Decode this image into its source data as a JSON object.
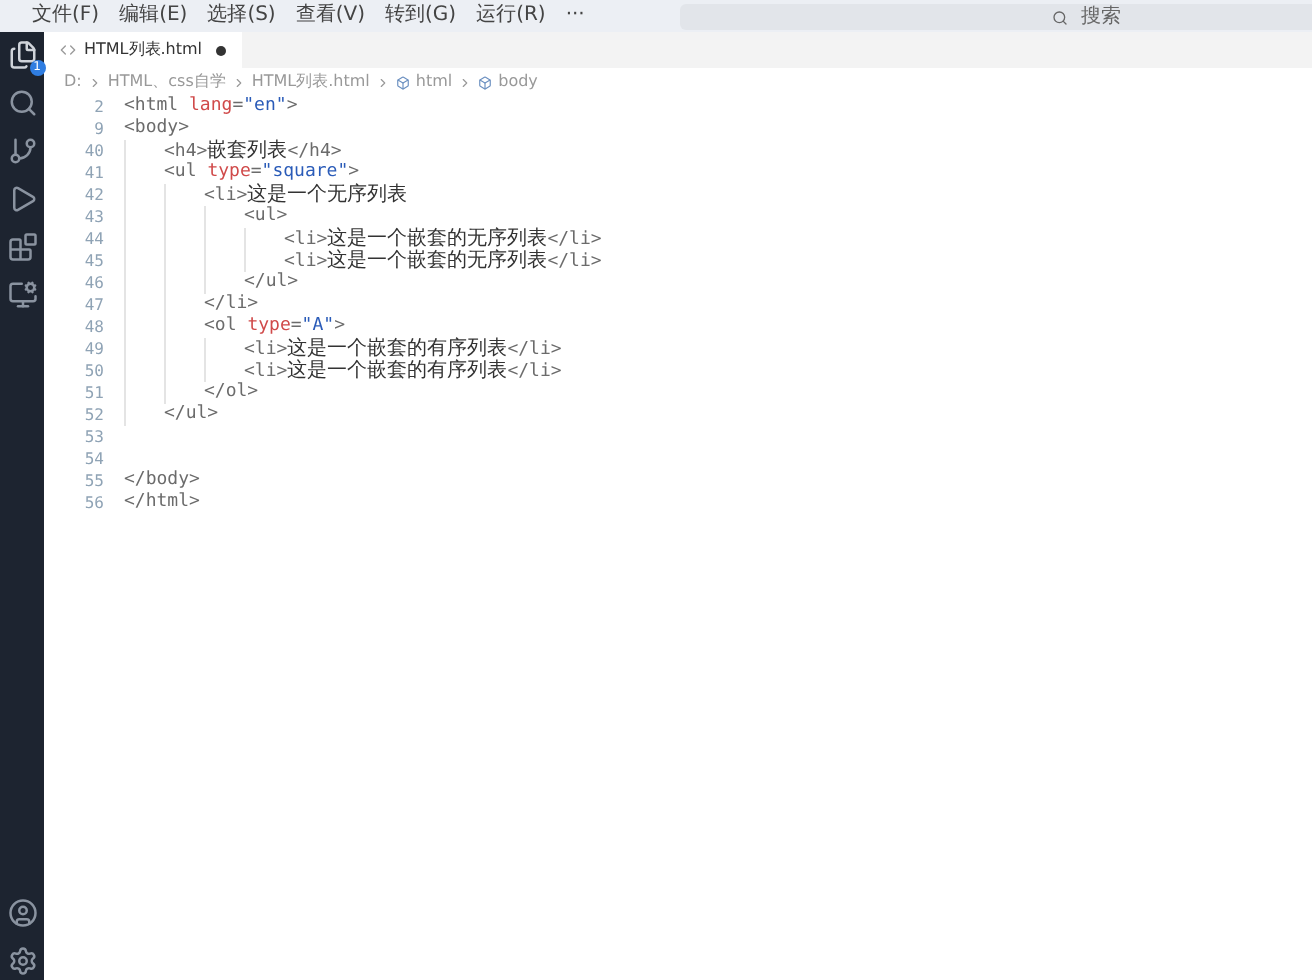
{
  "menu_bar": {
    "items": [
      "文件(F)",
      "编辑(E)",
      "选择(S)",
      "查看(V)",
      "转到(G)",
      "运行(R)",
      "···"
    ],
    "search": {
      "placeholder": "搜索"
    }
  },
  "activity_bar": {
    "explorer_badge": "1"
  },
  "tabs": [
    {
      "label": "HTML列表.html",
      "selected": true,
      "modified": true
    }
  ],
  "breadcrumb": [
    "D:",
    "HTML、css自学",
    "HTML列表.html",
    "html",
    "body"
  ],
  "code_lines": [
    {
      "number": "2",
      "tokens": [
        {
          "kind": "tag",
          "text": "<html "
        },
        {
          "kind": "attr",
          "text": "lang"
        },
        {
          "kind": "tag",
          "text": "="
        },
        {
          "kind": "value",
          "text": "\"en\""
        },
        {
          "kind": "tag",
          "text": ">"
        }
      ]
    },
    {
      "number": "9",
      "tokens": [
        {
          "kind": "tag",
          "text": "<body>"
        }
      ],
      "children": [
        {
          "number": "40",
          "tokens": [
            {
              "kind": "tag",
              "text": "<h4>"
            },
            {
              "kind": "text",
              "text": "嵌套列表"
            },
            {
              "kind": "tag",
              "text": "</h4>"
            }
          ]
        },
        {
          "number": "41",
          "tokens": [
            {
              "kind": "tag",
              "text": "<ul "
            },
            {
              "kind": "attr",
              "text": "type"
            },
            {
              "kind": "tag",
              "text": "="
            },
            {
              "kind": "value",
              "text": "\"square\""
            },
            {
              "kind": "tag",
              "text": ">"
            }
          ],
          "children": [
            {
              "number": "42",
              "tokens": [
                {
                  "kind": "tag",
                  "text": "<li>"
                },
                {
                  "kind": "text",
                  "text": "这是一个无序列表"
                }
              ],
              "children": [
                {
                  "number": "43",
                  "tokens": [
                    {
                      "kind": "tag",
                      "text": "<ul>"
                    }
                  ],
                  "children": [
                    {
                      "number": "44",
                      "tokens": [
                        {
                          "kind": "tag",
                          "text": "<li>"
                        },
                        {
                          "kind": "text",
                          "text": "这是一个嵌套的无序列表"
                        },
                        {
                          "kind": "tag",
                          "text": "</li>"
                        }
                      ]
                    },
                    {
                      "number": "45",
                      "tokens": [
                        {
                          "kind": "tag",
                          "text": "<li>"
                        },
                        {
                          "kind": "text",
                          "text": "这是一个嵌套的无序列表"
                        },
                        {
                          "kind": "tag",
                          "text": "</li>"
                        }
                      ]
                    }
                  ]
                },
                {
                  "number": "46",
                  "tokens": [
                    {
                      "kind": "tag",
                      "text": "</ul>"
                    }
                  ]
                }
              ]
            },
            {
              "number": "47",
              "tokens": [
                {
                  "kind": "tag",
                  "text": "</li>"
                }
              ]
            },
            {
              "number": "48",
              "tokens": [
                {
                  "kind": "tag",
                  "text": "<ol "
                },
                {
                  "kind": "attr",
                  "text": "type"
                },
                {
                  "kind": "tag",
                  "text": "="
                },
                {
                  "kind": "value",
                  "text": "\"A\""
                },
                {
                  "kind": "tag",
                  "text": ">"
                }
              ],
              "children": [
                {
                  "number": "49",
                  "tokens": [
                    {
                      "kind": "tag",
                      "text": "<li>"
                    },
                    {
                      "kind": "text",
                      "text": "这是一个嵌套的有序列表"
                    },
                    {
                      "kind": "tag",
                      "text": "</li>"
                    }
                  ]
                },
                {
                  "number": "50",
                  "tokens": [
                    {
                      "kind": "tag",
                      "text": "<li>"
                    },
                    {
                      "kind": "text",
                      "text": "这是一个嵌套的有序列表"
                    },
                    {
                      "kind": "tag",
                      "text": "</li>"
                    }
                  ]
                }
              ]
            },
            {
              "number": "51",
              "tokens": [
                {
                  "kind": "tag",
                  "text": "</ol>"
                }
              ]
            }
          ]
        },
        {
          "number": "52",
          "tokens": [
            {
              "kind": "tag",
              "text": "</ul>"
            }
          ]
        }
      ]
    },
    {
      "number": "53"
    },
    {
      "number": "54"
    },
    {
      "number": "55",
      "tokens": [
        {
          "kind": "tag",
          "text": "</body>"
        }
      ]
    },
    {
      "number": "56",
      "tokens": [
        {
          "kind": "tag",
          "text": "</html>"
        }
      ]
    }
  ]
}
